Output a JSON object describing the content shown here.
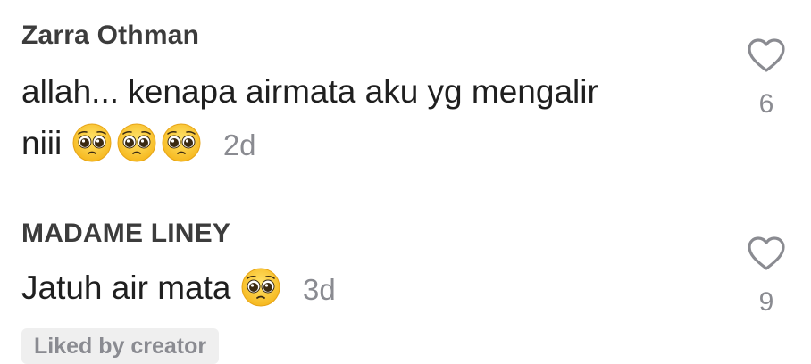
{
  "comments": [
    {
      "username": "Zarra Othman",
      "text_line1": "allah... kenapa airmata aku yg mengalir",
      "text_line2": "niii",
      "emoji_icon": "pleading-face-icon",
      "emoji_count": 3,
      "timestamp": "2d",
      "like_icon": "heart-outline-icon",
      "likes": "6"
    },
    {
      "username": "MADAME LINEY",
      "text": "Jatuh air mata",
      "emoji_icon": "pleading-face-icon",
      "emoji_count": 1,
      "timestamp": "3d",
      "like_icon": "heart-outline-icon",
      "likes": "9",
      "badge": "Liked by creator"
    }
  ],
  "colors": {
    "username": "#3c3c3c",
    "text": "#1f1f1f",
    "muted": "#8a8b91",
    "badge_bg": "#efefef",
    "emoji_face": "#f9c623"
  }
}
